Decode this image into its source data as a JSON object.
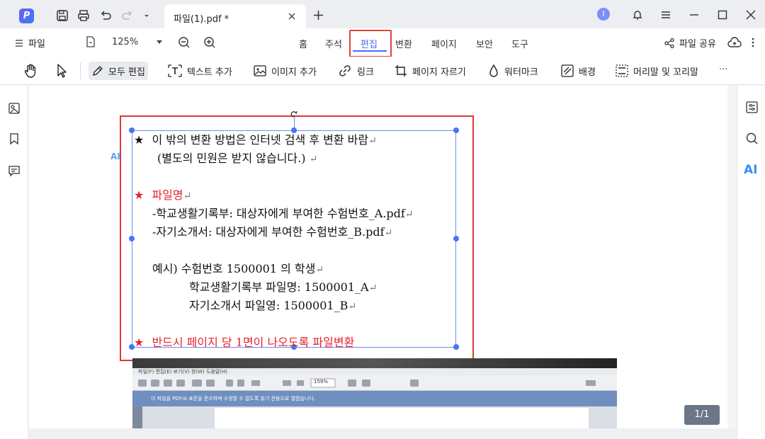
{
  "titlebar": {
    "app_logo": "P",
    "tab_title": "파일(1).pdf *",
    "avatar_initial": "I"
  },
  "menu": {
    "file_label": "파일",
    "zoom_value": "125%",
    "nav_tabs": [
      "홈",
      "주석",
      "편집",
      "변환",
      "페이지",
      "보안",
      "도구"
    ],
    "active_tab": "편집",
    "share_label": "파일 공유"
  },
  "toolbar": {
    "edit_all": "모두 편집",
    "add_text": "텍스트 추가",
    "add_image": "이미지 추가",
    "link": "링크",
    "crop_page": "페이지 자르기",
    "watermark": "워터마크",
    "background": "배경",
    "header_footer": "머리말 및 꼬리말",
    "more": "···"
  },
  "document": {
    "ai_badge": "AI",
    "lines": [
      {
        "star": "★",
        "text": "이 밖의 변환 방법은 인터넷 검색 후 변환 바람",
        "ret": "↵",
        "color": "black"
      },
      {
        "star": "",
        "text": "(별도의 민원은 받지 않습니다.)",
        "ret": "↵",
        "color": "black"
      },
      {
        "star": "★",
        "text": "파일명",
        "ret": "↵",
        "color": "red"
      },
      {
        "star": "",
        "text": "-학교생활기록부: 대상자에게 부여한 수험번호_A.pdf",
        "ret": "↵",
        "color": "black"
      },
      {
        "star": "",
        "text": "-자기소개서: 대상자에게 부여한 수험번호_B.pdf",
        "ret": "↵",
        "color": "black"
      },
      {
        "star": "",
        "text": "예시) 수험번호 1500001 의 학생",
        "ret": "↵",
        "color": "black"
      },
      {
        "star": "",
        "text": "학교생활기록부 파일명: 1500001_A",
        "ret": "↵",
        "color": "black"
      },
      {
        "star": "",
        "text": "자기소개서 파일영: 1500001_B",
        "ret": "↵",
        "color": "black"
      },
      {
        "star": "★",
        "text": "반드시 페이지 당 1면이 나오도록 파일변환",
        "ret": "",
        "color": "red"
      }
    ],
    "screenshot_menu": "파일(F)  편집(E)  보기(V)  창(W)  도움말(H)",
    "screenshot_info": "이 파일을 PDF/A 표준을 준수하며 수정할 수 없도록 읽기 전용으로 열렸습니다.",
    "screenshot_zoom": "159%"
  },
  "page_indicator": "1/1",
  "right_ai": "AI"
}
